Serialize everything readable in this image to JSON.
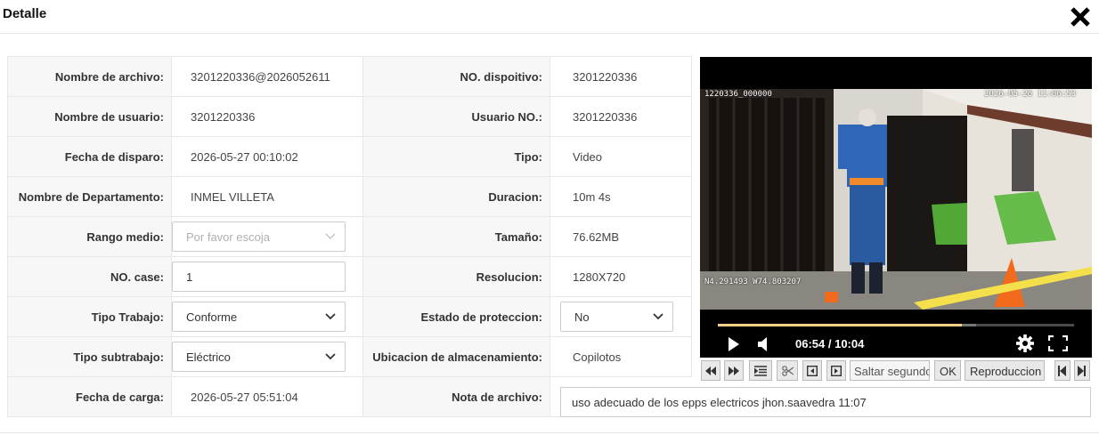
{
  "dialog": {
    "title": "Detalle",
    "close_icon": "close-icon"
  },
  "fields": {
    "nombre_archivo": {
      "label": "Nombre de archivo:",
      "value": "3201220336@2026052611"
    },
    "no_dispositivo": {
      "label": "NO. dispoitivo:",
      "value": "3201220336"
    },
    "nombre_usuario": {
      "label": "Nombre de usuario:",
      "value": "3201220336"
    },
    "usuario_no": {
      "label": "Usuario NO.:",
      "value": "3201220336"
    },
    "fecha_disparo": {
      "label": "Fecha de disparo:",
      "value": "2026-05-27 00:10:02"
    },
    "tipo": {
      "label": "Tipo:",
      "value": "Video"
    },
    "nombre_departamento": {
      "label": "Nombre de Departamento:",
      "value": "INMEL VILLETA"
    },
    "duracion": {
      "label": "Duracion:",
      "value": "10m 4s"
    },
    "rango_medio": {
      "label": "Rango medio:",
      "placeholder": "Por favor escoja"
    },
    "tamano": {
      "label": "Tamaño:",
      "value": "76.62MB"
    },
    "no_case": {
      "label": "NO. case:",
      "value": "1"
    },
    "resolucion": {
      "label": "Resolucion:",
      "value": "1280X720"
    },
    "tipo_trabajo": {
      "label": "Tipo Trabajo:",
      "value": "Conforme"
    },
    "estado_proteccion": {
      "label": "Estado de proteccion:",
      "value": "No"
    },
    "tipo_subtrabajo": {
      "label": "Tipo subtrabajo:",
      "value": "Eléctrico"
    },
    "ubicacion_almacenamiento": {
      "label": "Ubicacion de almacenamiento:",
      "value": "Copilotos"
    },
    "fecha_carga": {
      "label": "Fecha de carga:",
      "value": "2026-05-27 05:51:04"
    },
    "nota_archivo": {
      "label": "Nota de archivo:",
      "value": "uso adecuado de los epps electricos jhon.saavedra 11:07"
    }
  },
  "video": {
    "osd_top_left": "1220336_000000",
    "osd_top_right": "2026-05-26 11:06:53",
    "osd_bottom_left": "N4.291493  W74.803207",
    "time_display": "06:54 / 10:04",
    "progress_fraction": 0.686,
    "buffered_fraction": 0.725
  },
  "toolbar": {
    "skip_placeholder": "Saltar segundos",
    "ok_label": "OK",
    "playback_label": "Reproduccion"
  }
}
